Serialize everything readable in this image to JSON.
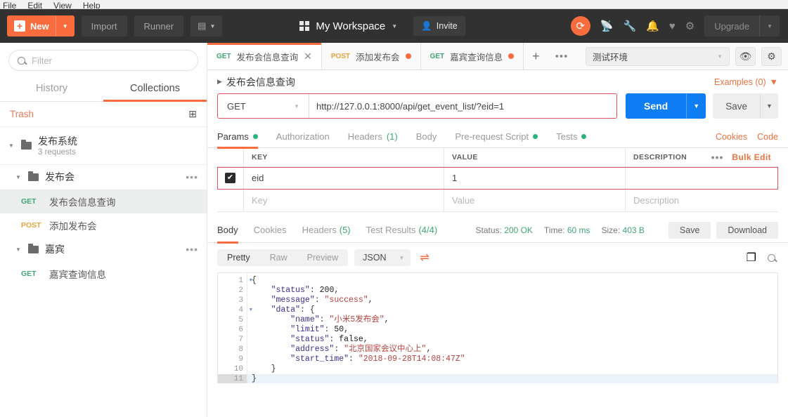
{
  "os_menu": [
    "File",
    "Edit",
    "View",
    "Help"
  ],
  "topbar": {
    "new_label": "New",
    "import_label": "Import",
    "runner_label": "Runner",
    "workspace_name": "My Workspace",
    "invite_label": "Invite",
    "upgrade_label": "Upgrade",
    "icons": [
      "sync-icon",
      "satellite-icon",
      "wrench-icon",
      "bell-icon",
      "heart-icon",
      "gear-icon"
    ],
    "accent_color": "#f96c3d",
    "bg_color": "#313131"
  },
  "sidebar": {
    "filter_placeholder": "Filter",
    "tabs": [
      {
        "label": "History",
        "active": false
      },
      {
        "label": "Collections",
        "active": true
      }
    ],
    "trash_label": "Trash",
    "collection": {
      "name": "发布系统",
      "sub": "3 requests"
    },
    "folders": [
      {
        "name": "发布会",
        "requests": [
          {
            "method": "GET",
            "name": "发布会信息查询",
            "selected": true
          },
          {
            "method": "POST",
            "name": "添加发布会",
            "selected": false
          }
        ]
      },
      {
        "name": "嘉宾",
        "requests": [
          {
            "method": "GET",
            "name": "嘉宾查询信息",
            "selected": false
          }
        ]
      }
    ]
  },
  "tabbar": {
    "tabs": [
      {
        "method": "GET",
        "name": "发布会信息查询",
        "active": true,
        "unsaved": false
      },
      {
        "method": "POST",
        "name": "添加发布会",
        "active": false,
        "unsaved": true
      },
      {
        "method": "GET",
        "name": "嘉宾查询信息",
        "active": false,
        "unsaved": true
      }
    ],
    "environment": "测试环境"
  },
  "request": {
    "title": "发布会信息查询",
    "examples_label": "Examples (0)",
    "method": "GET",
    "url": "http://127.0.0.1:8000/api/get_event_list/?eid=1",
    "send_label": "Send",
    "save_label": "Save",
    "subtabs": [
      {
        "label": "Params",
        "active": true,
        "dot": true,
        "count": ""
      },
      {
        "label": "Authorization",
        "active": false,
        "dot": false,
        "count": ""
      },
      {
        "label": "Headers",
        "active": false,
        "dot": false,
        "count": "(1)"
      },
      {
        "label": "Body",
        "active": false,
        "dot": false,
        "count": ""
      },
      {
        "label": "Pre-request Script",
        "active": false,
        "dot": true,
        "count": ""
      },
      {
        "label": "Tests",
        "active": false,
        "dot": true,
        "count": ""
      }
    ],
    "cookies_label": "Cookies",
    "code_label": "Code"
  },
  "params": {
    "headers": {
      "key": "KEY",
      "value": "VALUE",
      "description": "DESCRIPTION"
    },
    "bulk_edit_label": "Bulk Edit",
    "rows": [
      {
        "checked": true,
        "key": "eid",
        "value": "1",
        "description": "",
        "highlighted": true
      }
    ],
    "placeholder_row": {
      "key": "Key",
      "value": "Value",
      "description": "Description"
    }
  },
  "response": {
    "tabs": [
      {
        "label": "Body",
        "active": true,
        "count": ""
      },
      {
        "label": "Cookies",
        "active": false,
        "count": ""
      },
      {
        "label": "Headers",
        "active": false,
        "count": "(5)"
      },
      {
        "label": "Test Results",
        "active": false,
        "count": "(4/4)"
      }
    ],
    "status_label": "Status:",
    "status_value": "200 OK",
    "time_label": "Time:",
    "time_value": "60 ms",
    "size_label": "Size:",
    "size_value": "403 B",
    "save_label": "Save",
    "download_label": "Download",
    "view_modes": [
      {
        "label": "Pretty",
        "active": true
      },
      {
        "label": "Raw",
        "active": false
      },
      {
        "label": "Preview",
        "active": false
      }
    ],
    "format": "JSON",
    "body_lines": [
      {
        "n": 1,
        "fold": true,
        "current": false,
        "tokens": [
          {
            "t": "p",
            "v": "{"
          }
        ]
      },
      {
        "n": 2,
        "fold": false,
        "current": false,
        "tokens": [
          {
            "t": "k",
            "v": "    \"status\""
          },
          {
            "t": "p",
            "v": ": "
          },
          {
            "t": "n",
            "v": "200"
          },
          {
            "t": "p",
            "v": ","
          }
        ]
      },
      {
        "n": 3,
        "fold": false,
        "current": false,
        "tokens": [
          {
            "t": "k",
            "v": "    \"message\""
          },
          {
            "t": "p",
            "v": ": "
          },
          {
            "t": "s",
            "v": "\"success\""
          },
          {
            "t": "p",
            "v": ","
          }
        ]
      },
      {
        "n": 4,
        "fold": true,
        "current": false,
        "tokens": [
          {
            "t": "k",
            "v": "    \"data\""
          },
          {
            "t": "p",
            "v": ": {"
          }
        ]
      },
      {
        "n": 5,
        "fold": false,
        "current": false,
        "tokens": [
          {
            "t": "k",
            "v": "        \"name\""
          },
          {
            "t": "p",
            "v": ": "
          },
          {
            "t": "s",
            "v": "\"小米5发布会\""
          },
          {
            "t": "p",
            "v": ","
          }
        ]
      },
      {
        "n": 6,
        "fold": false,
        "current": false,
        "tokens": [
          {
            "t": "k",
            "v": "        \"limit\""
          },
          {
            "t": "p",
            "v": ": "
          },
          {
            "t": "n",
            "v": "50"
          },
          {
            "t": "p",
            "v": ","
          }
        ]
      },
      {
        "n": 7,
        "fold": false,
        "current": false,
        "tokens": [
          {
            "t": "k",
            "v": "        \"status\""
          },
          {
            "t": "p",
            "v": ": "
          },
          {
            "t": "n",
            "v": "false"
          },
          {
            "t": "p",
            "v": ","
          }
        ]
      },
      {
        "n": 8,
        "fold": false,
        "current": false,
        "tokens": [
          {
            "t": "k",
            "v": "        \"address\""
          },
          {
            "t": "p",
            "v": ": "
          },
          {
            "t": "s",
            "v": "\"北京国家会议中心上\""
          },
          {
            "t": "p",
            "v": ","
          }
        ]
      },
      {
        "n": 9,
        "fold": false,
        "current": false,
        "tokens": [
          {
            "t": "k",
            "v": "        \"start_time\""
          },
          {
            "t": "p",
            "v": ": "
          },
          {
            "t": "s",
            "v": "\"2018-09-28T14:08:47Z\""
          }
        ]
      },
      {
        "n": 10,
        "fold": false,
        "current": false,
        "tokens": [
          {
            "t": "p",
            "v": "    }"
          }
        ]
      },
      {
        "n": 11,
        "fold": false,
        "current": true,
        "tokens": [
          {
            "t": "p",
            "v": "}"
          }
        ]
      }
    ]
  }
}
